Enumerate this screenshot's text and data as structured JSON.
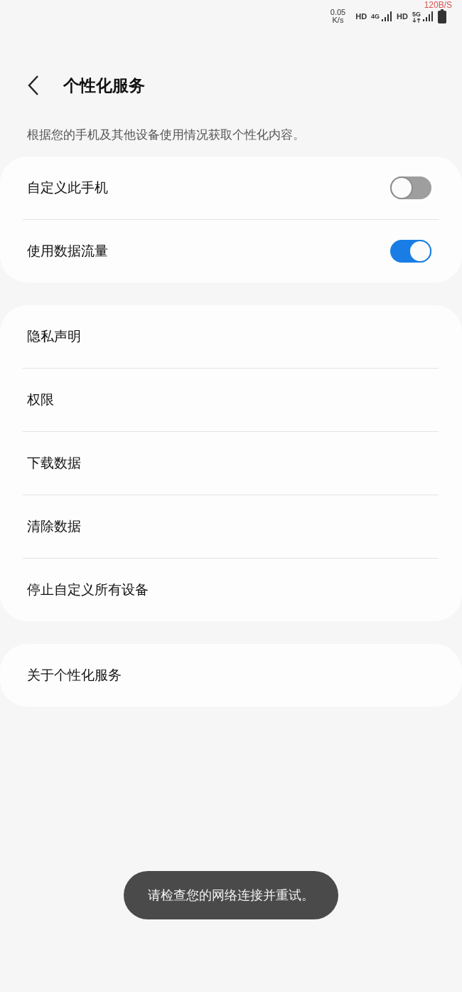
{
  "status_bar": {
    "net_speed_value": "0.05",
    "net_speed_unit": "K/s",
    "hd_1": "HD",
    "net_1": "4G",
    "hd_2": "HD",
    "net_2": "5G",
    "speed_overlay": "120B/S"
  },
  "header": {
    "title": "个性化服务"
  },
  "description": "根据您的手机及其他设备使用情况获取个性化内容。",
  "groups": [
    {
      "items": [
        {
          "label": "自定义此手机",
          "kind": "switch",
          "on": false
        },
        {
          "label": "使用数据流量",
          "kind": "switch",
          "on": true
        }
      ]
    },
    {
      "items": [
        {
          "label": "隐私声明",
          "kind": "link"
        },
        {
          "label": "权限",
          "kind": "link"
        },
        {
          "label": "下载数据",
          "kind": "link"
        },
        {
          "label": "清除数据",
          "kind": "link"
        },
        {
          "label": "停止自定义所有设备",
          "kind": "link"
        }
      ]
    },
    {
      "items": [
        {
          "label": "关于个性化服务",
          "kind": "link"
        }
      ]
    }
  ],
  "toast": "请检查您的网络连接并重试。"
}
